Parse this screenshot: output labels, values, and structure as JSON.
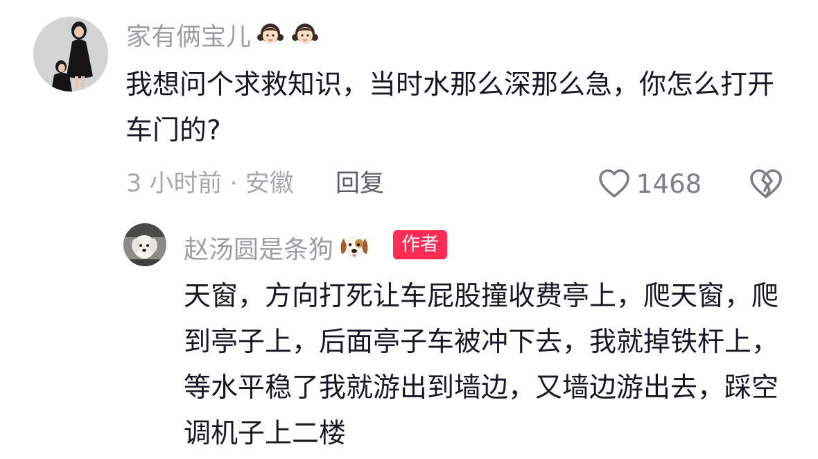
{
  "comment": {
    "username": "家有俩宝儿",
    "username_emojis": [
      "girl-face-emoji",
      "girl-face-emoji"
    ],
    "text": "我想问个求救知识，当时水那么深那么急，你怎么打开车门的?",
    "meta": "3 小时前 · 安徽",
    "reply_label": "回复",
    "like_count": "1468"
  },
  "reply": {
    "username": "赵汤圆是条狗",
    "username_emoji": "dog-face-emoji",
    "badge": "作者",
    "text": "天窗，方向打死让车屁股撞收费亭上，爬天窗，爬到亭子上，后面亭子车被冲下去，我就掉铁杆上，等水平稳了我就游出到墙边，又墙边游出去，踩空调机子上二楼"
  },
  "colors": {
    "username": "#9e9ea2",
    "body_text": "#161823",
    "meta": "#a8a8ac",
    "badge_bg": "#fe2c55"
  }
}
